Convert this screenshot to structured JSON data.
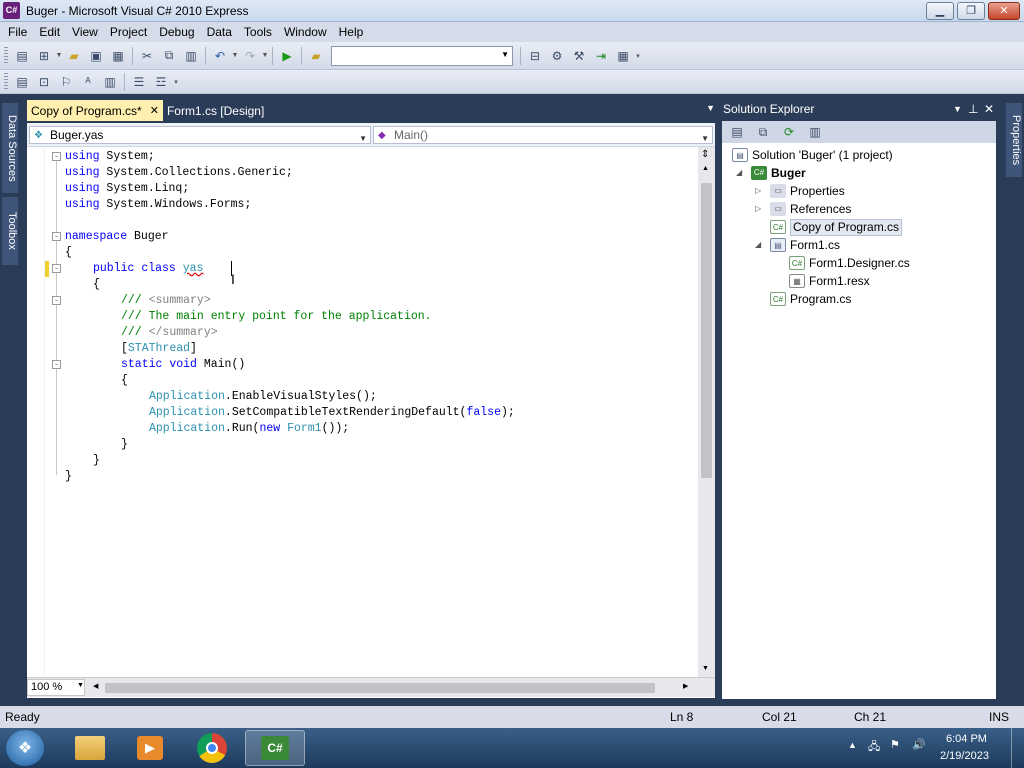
{
  "window": {
    "title": "Buger - Microsoft Visual C# 2010 Express",
    "app_icon_text": "C#"
  },
  "menu": [
    "File",
    "Edit",
    "View",
    "Project",
    "Debug",
    "Data",
    "Tools",
    "Window",
    "Help"
  ],
  "doc_tabs": [
    {
      "label": "Copy of Program.cs*",
      "active": true
    },
    {
      "label": "Form1.cs [Design]",
      "active": false
    }
  ],
  "nav": {
    "type_selector": "Buger.yas",
    "member_selector": "Main()"
  },
  "code_lines": [
    {
      "line": 1,
      "fold": "-",
      "indent": 0,
      "parts": [
        {
          "t": "using",
          "c": "kw"
        },
        {
          "t": " System;"
        }
      ]
    },
    {
      "line": 2,
      "indent": 0,
      "parts": [
        {
          "t": "using",
          "c": "kw"
        },
        {
          "t": " System.Collections.Generic;"
        }
      ]
    },
    {
      "line": 3,
      "indent": 0,
      "parts": [
        {
          "t": "using",
          "c": "kw"
        },
        {
          "t": " System.Linq;"
        }
      ]
    },
    {
      "line": 4,
      "indent": 0,
      "parts": [
        {
          "t": "using",
          "c": "kw"
        },
        {
          "t": " System.Windows.Forms;"
        }
      ]
    },
    {
      "line": 5,
      "indent": 0,
      "parts": []
    },
    {
      "line": 6,
      "fold": "-",
      "indent": 0,
      "parts": [
        {
          "t": "namespace",
          "c": "kw"
        },
        {
          "t": " Buger"
        }
      ]
    },
    {
      "line": 7,
      "indent": 0,
      "parts": [
        {
          "t": "{"
        }
      ]
    },
    {
      "line": 8,
      "fold": "-",
      "indent": 1,
      "changed": true,
      "parts": [
        {
          "t": "public",
          "c": "kw"
        },
        {
          "t": " "
        },
        {
          "t": "class",
          "c": "kw"
        },
        {
          "t": " "
        },
        {
          "t": "yas",
          "c": "type",
          "squiggle": true
        }
      ]
    },
    {
      "line": 9,
      "indent": 1,
      "parts": [
        {
          "t": "{"
        }
      ]
    },
    {
      "line": 10,
      "fold": "-",
      "indent": 2,
      "parts": [
        {
          "t": "/// ",
          "c": "cmt"
        },
        {
          "t": "<summary>",
          "c": "doc"
        }
      ]
    },
    {
      "line": 11,
      "indent": 2,
      "parts": [
        {
          "t": "/// The main entry point for the application.",
          "c": "cmt"
        }
      ]
    },
    {
      "line": 12,
      "indent": 2,
      "parts": [
        {
          "t": "/// ",
          "c": "cmt"
        },
        {
          "t": "</summary>",
          "c": "doc"
        }
      ]
    },
    {
      "line": 13,
      "indent": 2,
      "parts": [
        {
          "t": "["
        },
        {
          "t": "STAThread",
          "c": "type"
        },
        {
          "t": "]"
        }
      ]
    },
    {
      "line": 14,
      "fold": "-",
      "indent": 2,
      "parts": [
        {
          "t": "static",
          "c": "kw"
        },
        {
          "t": " "
        },
        {
          "t": "void",
          "c": "kw"
        },
        {
          "t": " Main()"
        }
      ]
    },
    {
      "line": 15,
      "indent": 2,
      "parts": [
        {
          "t": "{"
        }
      ]
    },
    {
      "line": 16,
      "indent": 3,
      "parts": [
        {
          "t": "Application",
          "c": "type"
        },
        {
          "t": ".EnableVisualStyles();"
        }
      ]
    },
    {
      "line": 17,
      "indent": 3,
      "parts": [
        {
          "t": "Application",
          "c": "type"
        },
        {
          "t": ".SetCompatibleTextRenderingDefault("
        },
        {
          "t": "false",
          "c": "kw"
        },
        {
          "t": ");"
        }
      ]
    },
    {
      "line": 18,
      "indent": 3,
      "parts": [
        {
          "t": "Application",
          "c": "type"
        },
        {
          "t": ".Run("
        },
        {
          "t": "new",
          "c": "kw"
        },
        {
          "t": " "
        },
        {
          "t": "Form1",
          "c": "type"
        },
        {
          "t": "());"
        }
      ]
    },
    {
      "line": 19,
      "indent": 2,
      "parts": [
        {
          "t": "}"
        }
      ]
    },
    {
      "line": 20,
      "indent": 1,
      "parts": [
        {
          "t": "}"
        }
      ]
    },
    {
      "line": 21,
      "indent": 0,
      "parts": [
        {
          "t": "}"
        }
      ]
    }
  ],
  "syntax_colors": {
    "kw": "#0000ff",
    "type": "#2b91af",
    "cmt": "#008000",
    "doc": "#808080",
    "text": "#000000"
  },
  "editor": {
    "zoom": "100 %"
  },
  "solution_explorer": {
    "title": "Solution Explorer",
    "items": [
      {
        "label": "Solution 'Buger' (1 project)",
        "level": 0,
        "icon": "solution-icon"
      },
      {
        "label": "Buger",
        "level": 1,
        "bold": true,
        "expander": "open",
        "icon": "csharp-project-icon"
      },
      {
        "label": "Properties",
        "level": 2,
        "expander": "closed",
        "icon": "properties-folder-icon"
      },
      {
        "label": "References",
        "level": 2,
        "expander": "closed",
        "icon": "references-folder-icon"
      },
      {
        "label": "Copy of Program.cs",
        "level": 2,
        "selected": true,
        "icon": "cs-file-icon"
      },
      {
        "label": "Form1.cs",
        "level": 2,
        "expander": "open",
        "icon": "form-icon"
      },
      {
        "label": "Form1.Designer.cs",
        "level": 3,
        "icon": "cs-file-icon"
      },
      {
        "label": "Form1.resx",
        "level": 3,
        "icon": "resx-file-icon"
      },
      {
        "label": "Program.cs",
        "level": 2,
        "icon": "cs-file-icon"
      }
    ]
  },
  "left_tabs": [
    "Data Sources",
    "Toolbox"
  ],
  "right_tabs": [
    "Properties"
  ],
  "status": {
    "left": "Ready",
    "ln": "Ln 8",
    "col": "Col 21",
    "ch": "Ch 21",
    "mode": "INS"
  },
  "taskbar": {
    "time": "6:04 PM",
    "date": "2/19/2023",
    "active_app_label": "C#"
  }
}
